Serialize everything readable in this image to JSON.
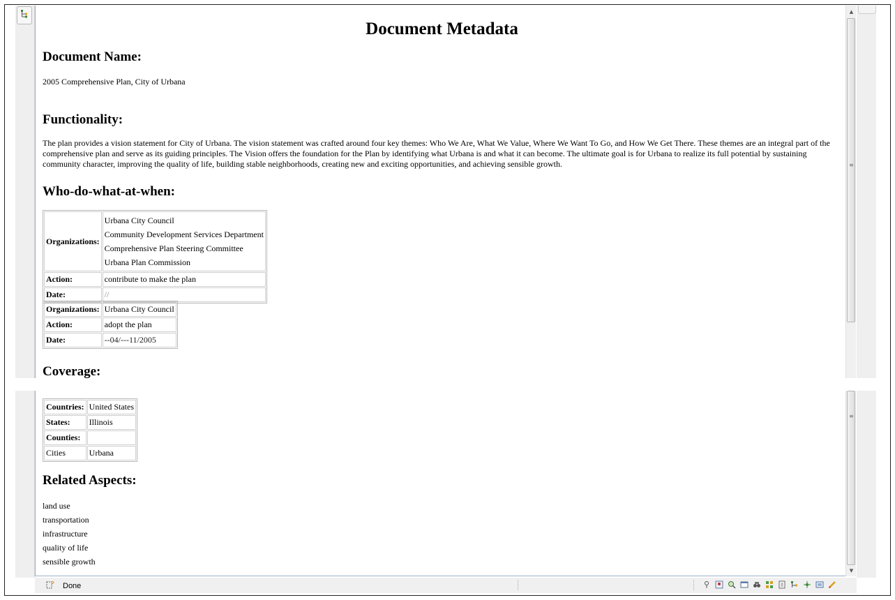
{
  "document": {
    "title": "Document Metadata",
    "name_heading": "Document Name:",
    "name": "2005 Comprehensive Plan, City of Urbana",
    "functionality_heading": "Functionality:",
    "functionality_text": "The plan provides a vision statement for City of Urbana. The vision statement was crafted around four key themes: Who We Are, What We Value, Where We Want To Go, and How We Get There. These themes are an integral part of the comprehensive plan and serve as its guiding principles. The Vision offers the foundation for the Plan by identifying what Urbana is and what it can become. The ultimate goal is for Urbana to realize its full potential by sustaining community character, improving the quality of life, building stable neighborhoods, creating new and exciting opportunities, and achieving sensible growth.",
    "who_heading": "Who-do-what-at-when:",
    "who_tables": [
      {
        "org_label": "Organizations:",
        "organizations": [
          "Urbana City Council",
          "Community Development Services Department",
          "Comprehensive Plan Steering Committee",
          "Urbana Plan Commission"
        ],
        "action_label": "Action:",
        "action": "contribute to make the plan",
        "date_label": "Date:",
        "date": "//"
      },
      {
        "org_label": "Organizations:",
        "organizations": [
          "Urbana City Council"
        ],
        "action_label": "Action:",
        "action": "adopt the plan",
        "date_label": "Date:",
        "date": "--04/---11/2005"
      }
    ],
    "coverage_heading": "Coverage:",
    "coverage": [
      {
        "label": "Countries:",
        "value": "United States",
        "bold": true
      },
      {
        "label": "States:",
        "value": "Illinois",
        "bold": true
      },
      {
        "label": "Counties:",
        "value": "",
        "bold": true
      },
      {
        "label": "Cities",
        "value": "Urbana",
        "bold": false
      }
    ],
    "related_heading": "Related Aspects:",
    "related_aspects": [
      "land use",
      "transportation",
      "infrastructure",
      "quality of life",
      "sensible growth"
    ]
  },
  "status_bar": {
    "status_text": "Done",
    "toolbar_icons": [
      "pin-icon",
      "map-marker-icon",
      "globe-search-icon",
      "window-icon",
      "binoculars-icon",
      "grid-icon",
      "document-icon",
      "tree-icon",
      "network-icon",
      "note-icon",
      "pencil-icon"
    ]
  },
  "colors": {
    "pane_border": "#9ab0c8",
    "gutter_bg": "#efefef"
  }
}
